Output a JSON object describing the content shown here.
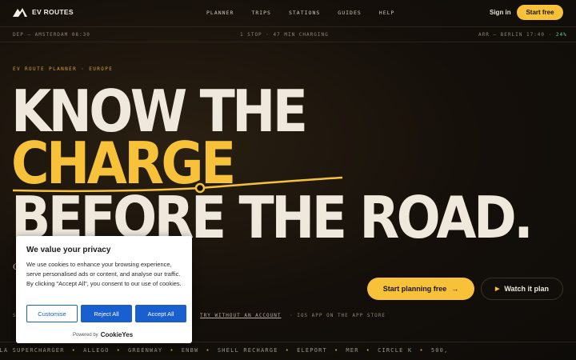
{
  "nav": {
    "brand": "EV ROUTES",
    "links": [
      "PLANNER",
      "TRIPS",
      "STATIONS",
      "GUIDES",
      "HELP"
    ],
    "signin": "Sign in",
    "cta": "Start free"
  },
  "ticker": {
    "dep": "DEP — AMSTERDAM 08:30",
    "mid": "1 STOP · 47 MIN CHARGING",
    "arr": "ARR — BERLIN 17:40 ·",
    "battery": "24%"
  },
  "hero": {
    "eyebrow": "EV ROUTE PLANNER · EUROPE",
    "line1": "KNOW THE",
    "line2": "CHARGE",
    "line3": "BEFORE THE ROAD.",
    "sub_text": "C                                                     oard: realistic r                                                   t. Before you l",
    "cta_primary": "Start planning free",
    "cta_secondary": "Watch it plan",
    "link_s": "S",
    "link_try": "TRY WITHOUT AN ACCOUNT",
    "link_ios": "· IOS APP ON THE APP STORE"
  },
  "brands": [
    "SLA SUPERCHARGER",
    "ALLEGO",
    "GREENWAY",
    "ENBW",
    "SHELL RECHARGE",
    "ELEPORT",
    "MER",
    "CIRCLE K",
    "500,"
  ],
  "cookie": {
    "title": "We value your privacy",
    "body": "We use cookies to enhance your browsing experience, serve personalised ads or content, and analyse our traffic. By clicking \"Accept All\", you consent to our use of cookies.",
    "customise": "Customise",
    "reject": "Reject All",
    "accept": "Accept All",
    "powered": "Powered by",
    "provider": "CookieYes"
  },
  "colors": {
    "accent": "#f7c23a",
    "battery": "#6fcf97",
    "consent_blue": "#1a5fd0"
  }
}
